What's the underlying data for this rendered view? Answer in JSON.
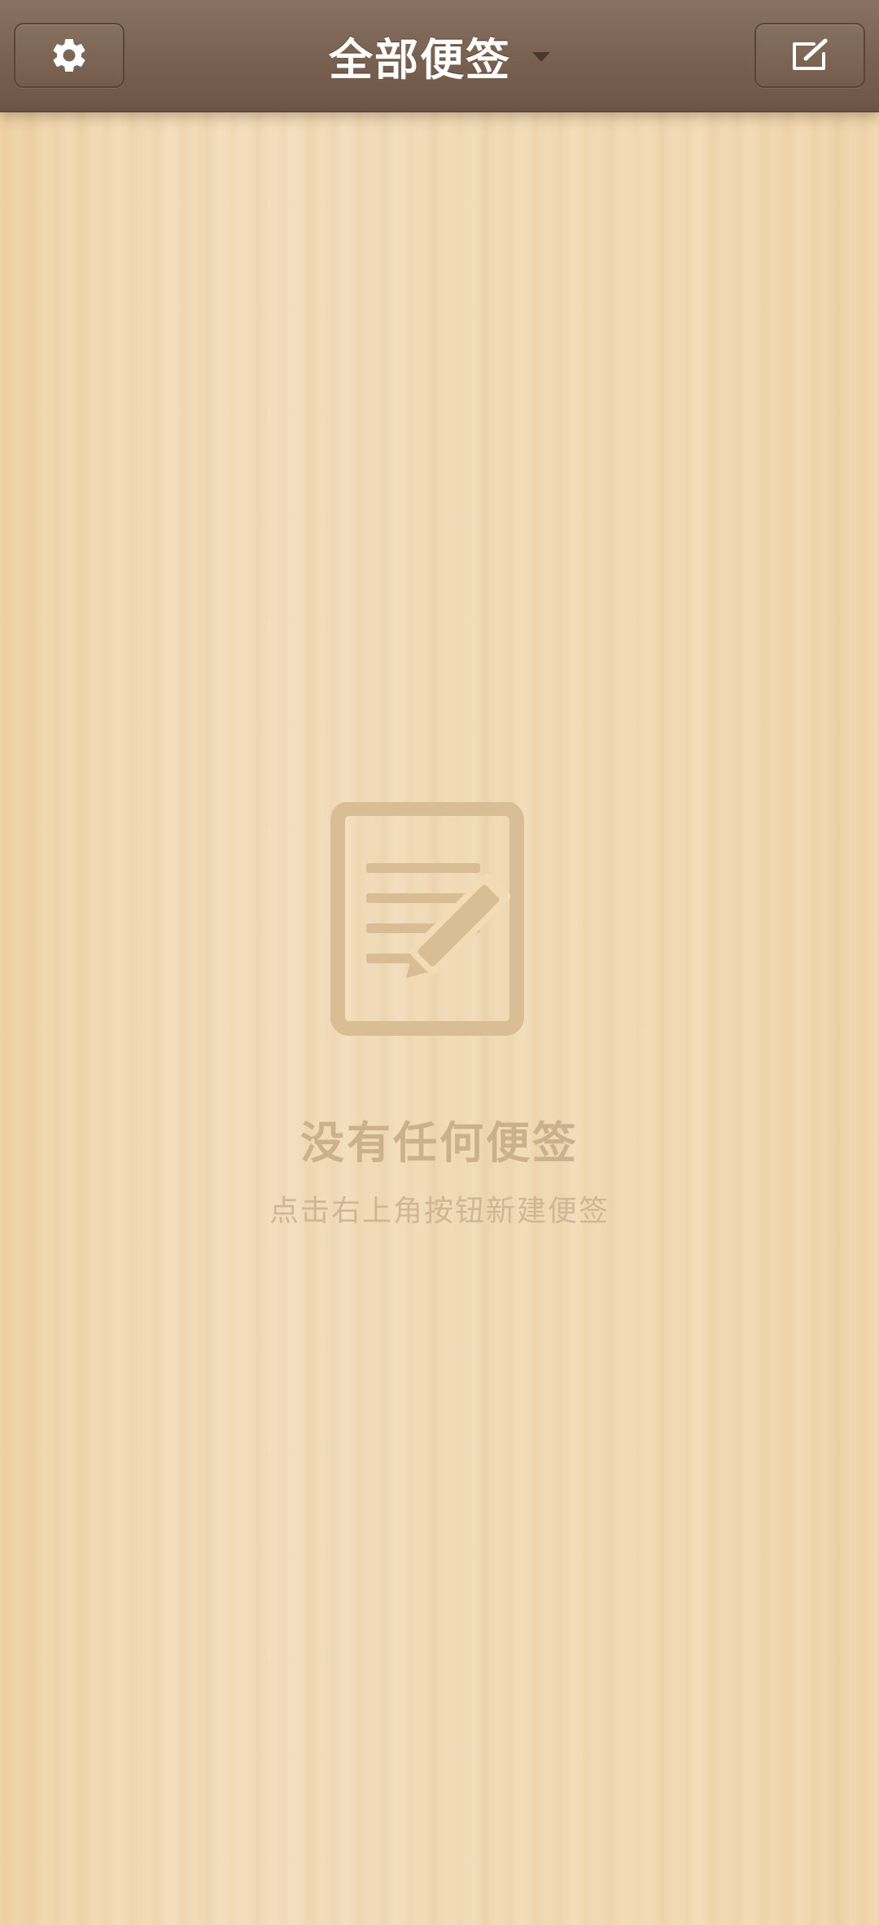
{
  "header": {
    "title": "全部便签",
    "settings_icon": "gear-icon",
    "new_note_icon": "compose-icon",
    "dropdown_icon": "caret-down-icon"
  },
  "empty_state": {
    "icon": "note-with-pencil-icon",
    "title": "没有任何便签",
    "subtitle": "点击右上角按钮新建便签"
  },
  "colors": {
    "toolbar": "#7a6252",
    "wood_background": "#f2dbb5",
    "empty_text": "#ccb18e",
    "icon_fill": "#d9bd95"
  }
}
